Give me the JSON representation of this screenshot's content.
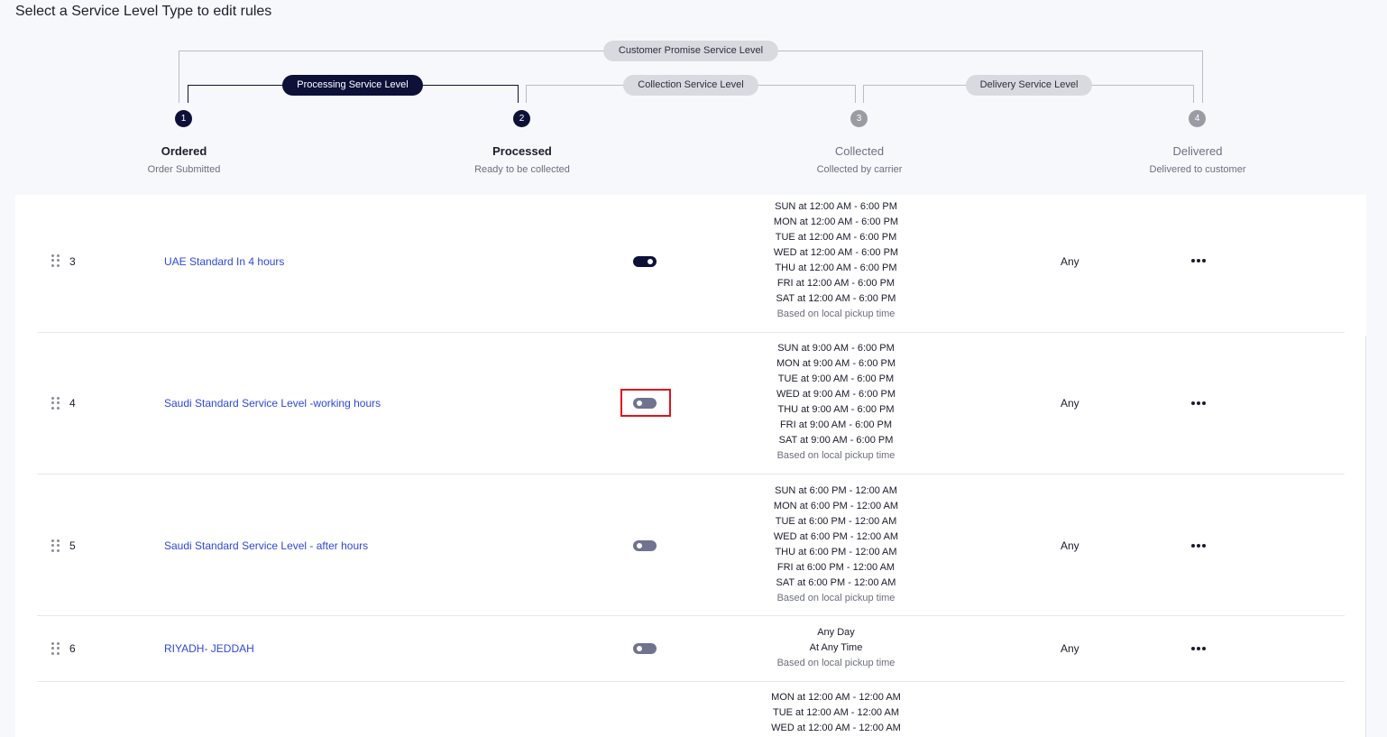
{
  "header": {
    "title": "Select a Service Level Type to edit rules"
  },
  "timeline": {
    "customer_promise": "Customer Promise Service Level",
    "processing": "Processing Service Level",
    "collection": "Collection Service Level",
    "delivery": "Delivery Service Level",
    "steps": [
      {
        "num": "1",
        "label": "Ordered",
        "sub": "Order Submitted"
      },
      {
        "num": "2",
        "label": "Processed",
        "sub": "Ready to be collected"
      },
      {
        "num": "3",
        "label": "Collected",
        "sub": "Collected by carrier"
      },
      {
        "num": "4",
        "label": "Delivered",
        "sub": "Delivered to customer"
      }
    ]
  },
  "rows": [
    {
      "num": "3",
      "name": "UAE Standard In 4 hours",
      "enabled": true,
      "schedule": [
        "SUN at 12:00 AM - 6:00 PM",
        "MON at 12:00 AM - 6:00 PM",
        "TUE at 12:00 AM - 6:00 PM",
        "WED at 12:00 AM - 6:00 PM",
        "THU at 12:00 AM - 6:00 PM",
        "FRI at 12:00 AM - 6:00 PM",
        "SAT at 12:00 AM - 6:00 PM"
      ],
      "note": "Based on local pickup time",
      "any": "Any"
    },
    {
      "num": "4",
      "name": "Saudi Standard Service Level -working hours",
      "enabled": false,
      "schedule": [
        "SUN at 9:00 AM - 6:00 PM",
        "MON at 9:00 AM - 6:00 PM",
        "TUE at 9:00 AM - 6:00 PM",
        "WED at 9:00 AM - 6:00 PM",
        "THU at 9:00 AM - 6:00 PM",
        "FRI at 9:00 AM - 6:00 PM",
        "SAT at 9:00 AM - 6:00 PM"
      ],
      "note": "Based on local pickup time",
      "any": "Any"
    },
    {
      "num": "5",
      "name": "Saudi Standard Service Level - after hours",
      "enabled": false,
      "schedule": [
        "SUN at 6:00 PM - 12:00 AM",
        "MON at 6:00 PM - 12:00 AM",
        "TUE at 6:00 PM - 12:00 AM",
        "WED at 6:00 PM - 12:00 AM",
        "THU at 6:00 PM - 12:00 AM",
        "FRI at 6:00 PM - 12:00 AM",
        "SAT at 6:00 PM - 12:00 AM"
      ],
      "note": "Based on local pickup time",
      "any": "Any"
    },
    {
      "num": "6",
      "name": "RIYADH- JEDDAH",
      "enabled": false,
      "schedule": [
        "Any Day",
        "At Any Time"
      ],
      "note": "Based on local pickup time",
      "any": "Any"
    },
    {
      "num": "",
      "name": "",
      "enabled": false,
      "schedule": [
        "MON at 12:00 AM - 12:00 AM",
        "TUE at 12:00 AM - 12:00 AM",
        "WED at 12:00 AM - 12:00 AM"
      ],
      "note": "",
      "any": ""
    }
  ],
  "colors": {
    "accent": "#0d1138",
    "link": "#2f48d8",
    "highlight": "#e0121f",
    "toggle_off": "#70738f"
  },
  "icons": {
    "drag": "drag-handle-icon",
    "more": "more-horizontal-icon"
  }
}
